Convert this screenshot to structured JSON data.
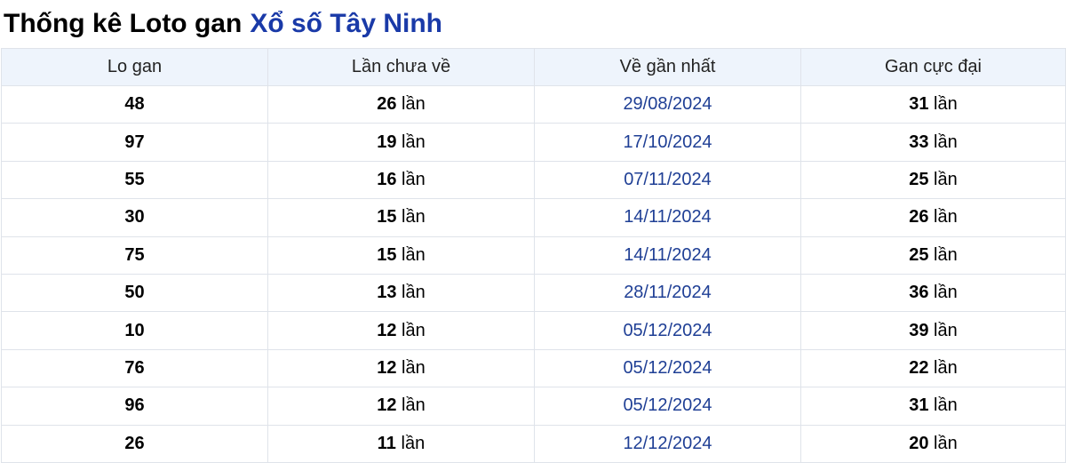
{
  "title": {
    "prefix": "Thống kê Loto gan",
    "link": "Xổ số Tây Ninh"
  },
  "headers": [
    "Lo gan",
    "Lần chưa về",
    "Về gần nhất",
    "Gan cực đại"
  ],
  "unit": "lần",
  "rows": [
    {
      "number": "48",
      "missed": "26",
      "last_date": "29/08/2024",
      "max_gap": "31"
    },
    {
      "number": "97",
      "missed": "19",
      "last_date": "17/10/2024",
      "max_gap": "33"
    },
    {
      "number": "55",
      "missed": "16",
      "last_date": "07/11/2024",
      "max_gap": "25"
    },
    {
      "number": "30",
      "missed": "15",
      "last_date": "14/11/2024",
      "max_gap": "26"
    },
    {
      "number": "75",
      "missed": "15",
      "last_date": "14/11/2024",
      "max_gap": "25"
    },
    {
      "number": "50",
      "missed": "13",
      "last_date": "28/11/2024",
      "max_gap": "36"
    },
    {
      "number": "10",
      "missed": "12",
      "last_date": "05/12/2024",
      "max_gap": "39"
    },
    {
      "number": "76",
      "missed": "12",
      "last_date": "05/12/2024",
      "max_gap": "22"
    },
    {
      "number": "96",
      "missed": "12",
      "last_date": "05/12/2024",
      "max_gap": "31"
    },
    {
      "number": "26",
      "missed": "11",
      "last_date": "12/12/2024",
      "max_gap": "20"
    }
  ]
}
